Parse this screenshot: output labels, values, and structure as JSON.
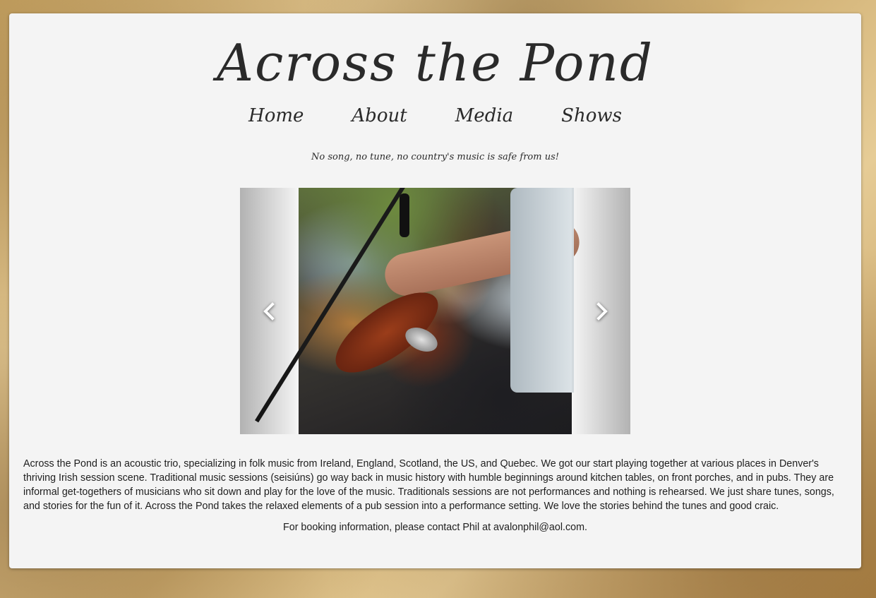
{
  "site": {
    "title": "Across the Pond",
    "tagline": "No song, no tune, no country's music is safe from us!"
  },
  "nav": {
    "items": [
      {
        "label": "Home"
      },
      {
        "label": "About"
      },
      {
        "label": "Media"
      },
      {
        "label": "Shows"
      }
    ]
  },
  "carousel": {
    "prev_icon": "chevron-left-icon",
    "next_icon": "chevron-right-icon"
  },
  "content": {
    "about": "Across the Pond is an acoustic trio, specializing in folk music from Ireland, England, Scotland, the US, and Quebec. We got our start playing together at various places in Denver's thriving Irish session scene. Traditional music sessions (seisiúns) go way back in music history with humble beginnings around kitchen tables, on front porches, and in pubs. They are informal get-togethers of musicians who sit down and play for the love of the music. Traditionals sessions are not performances and nothing is rehearsed. We just share tunes, songs, and stories for the fun of it. Across the Pond takes the relaxed elements of a pub session into a performance setting. We love the stories behind the tunes and good craic.",
    "booking_prefix": "For booking information, please contact Phil at ",
    "booking_email": "avalonphil@aol.com",
    "booking_suffix": "."
  },
  "colors": {
    "panel": "#f4f4f4",
    "text": "#1e1e1e"
  }
}
